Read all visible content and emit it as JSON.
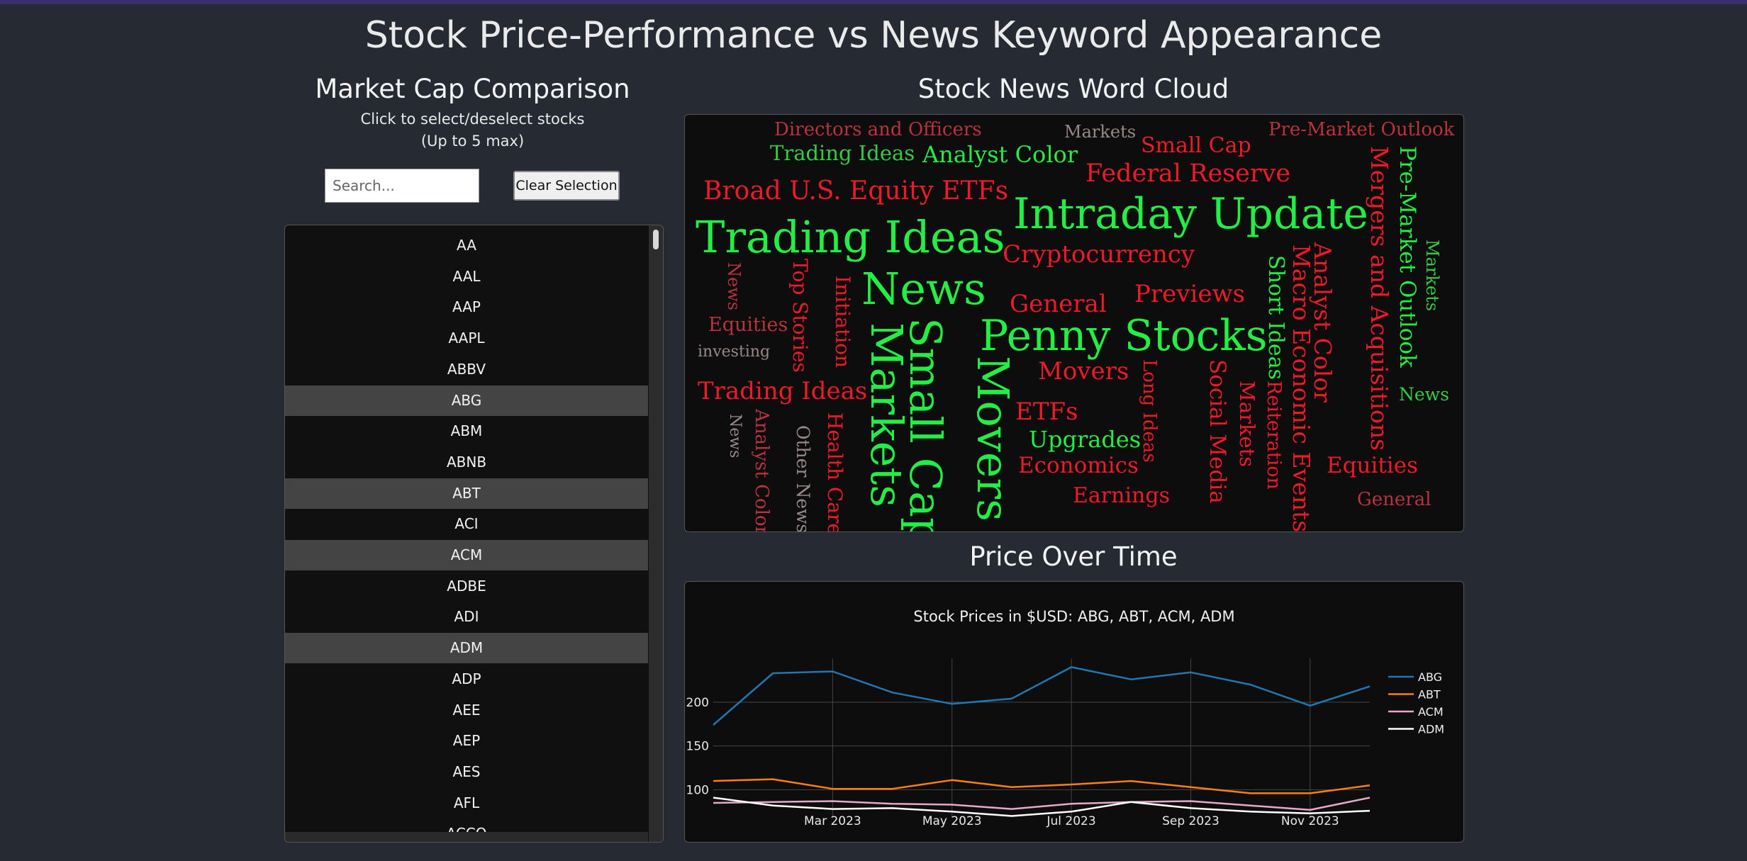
{
  "page": {
    "title": "Stock Price-Performance vs News Keyword Appearance"
  },
  "market_cap": {
    "title": "Market Cap Comparison",
    "subtitle_line1": "Click to select/deselect stocks",
    "subtitle_line2": "(Up to 5 max)",
    "search_placeholder": "Search...",
    "clear_label": "Clear Selection",
    "stocks": [
      {
        "symbol": "AA",
        "selected": false
      },
      {
        "symbol": "AAL",
        "selected": false
      },
      {
        "symbol": "AAP",
        "selected": false
      },
      {
        "symbol": "AAPL",
        "selected": false
      },
      {
        "symbol": "ABBV",
        "selected": false
      },
      {
        "symbol": "ABG",
        "selected": true
      },
      {
        "symbol": "ABM",
        "selected": false
      },
      {
        "symbol": "ABNB",
        "selected": false
      },
      {
        "symbol": "ABT",
        "selected": true
      },
      {
        "symbol": "ACI",
        "selected": false
      },
      {
        "symbol": "ACM",
        "selected": true
      },
      {
        "symbol": "ADBE",
        "selected": false
      },
      {
        "symbol": "ADI",
        "selected": false
      },
      {
        "symbol": "ADM",
        "selected": true
      },
      {
        "symbol": "ADP",
        "selected": false
      },
      {
        "symbol": "AEE",
        "selected": false
      },
      {
        "symbol": "AEP",
        "selected": false
      },
      {
        "symbol": "AES",
        "selected": false
      },
      {
        "symbol": "AFL",
        "selected": false
      },
      {
        "symbol": "ACCO",
        "selected": false
      }
    ]
  },
  "word_cloud": {
    "title": "Stock News Word Cloud",
    "colors": {
      "bright_green": "#22ee44",
      "mid_green": "#33cc44",
      "red": "#ee1a2a",
      "dark_red": "#b8333d",
      "gray": "#9a8888"
    },
    "words": [
      {
        "text": "Directors and Officers",
        "color": "dark_red"
      },
      {
        "text": "Markets",
        "color": "gray"
      },
      {
        "text": "Pre-Market Outlook",
        "color": "dark_red"
      },
      {
        "text": "Trading Ideas",
        "color": "mid_green"
      },
      {
        "text": "Analyst Color",
        "color": "bright_green"
      },
      {
        "text": "Small Cap",
        "color": "red"
      },
      {
        "text": "Federal Reserve",
        "color": "red"
      },
      {
        "text": "Broad U.S. Equity ETFs",
        "color": "red"
      },
      {
        "text": "Intraday Update",
        "color": "bright_green"
      },
      {
        "text": "Trading Ideas",
        "color": "bright_green"
      },
      {
        "text": "Cryptocurrency",
        "color": "red"
      },
      {
        "text": "News",
        "color": "bright_green"
      },
      {
        "text": "General",
        "color": "red"
      },
      {
        "text": "Previews",
        "color": "red"
      },
      {
        "text": "Penny Stocks",
        "color": "bright_green"
      },
      {
        "text": "Equities",
        "color": "dark_red"
      },
      {
        "text": "investing",
        "color": "gray"
      },
      {
        "text": "Movers",
        "color": "red"
      },
      {
        "text": "Trading Ideas",
        "color": "red"
      },
      {
        "text": "ETFs",
        "color": "red"
      },
      {
        "text": "Upgrades",
        "color": "bright_green"
      },
      {
        "text": "Economics",
        "color": "red"
      },
      {
        "text": "Earnings",
        "color": "red"
      },
      {
        "text": "News",
        "color": "mid_green"
      },
      {
        "text": "Equities",
        "color": "red"
      },
      {
        "text": "General",
        "color": "dark_red"
      },
      {
        "text": "Mergers and Acquisitions",
        "color": "red"
      },
      {
        "text": "Pre-Market Outlook",
        "color": "bright_green"
      },
      {
        "text": "Markets",
        "color": "mid_green"
      },
      {
        "text": "Analyst Color",
        "color": "red"
      },
      {
        "text": "Macro Economic Events",
        "color": "red"
      },
      {
        "text": "Short Ideas",
        "color": "bright_green"
      },
      {
        "text": "Reiteration",
        "color": "red"
      },
      {
        "text": "Markets",
        "color": "red"
      },
      {
        "text": "Social Media",
        "color": "red"
      },
      {
        "text": "Long Ideas",
        "color": "red"
      },
      {
        "text": "Movers",
        "color": "bright_green"
      },
      {
        "text": "Small Cap",
        "color": "bright_green"
      },
      {
        "text": "Markets",
        "color": "bright_green"
      },
      {
        "text": "Initiation",
        "color": "red"
      },
      {
        "text": "Top Stories",
        "color": "red"
      },
      {
        "text": "News",
        "color": "dark_red"
      },
      {
        "text": "Health Care",
        "color": "red"
      },
      {
        "text": "Other News",
        "color": "gray"
      },
      {
        "text": "Analyst Color",
        "color": "dark_red"
      },
      {
        "text": "News",
        "color": "gray"
      }
    ]
  },
  "price_chart": {
    "section_title": "Price Over Time",
    "colors": {
      "ABG": "#1f77b4",
      "ABT": "#ff7f0e",
      "ACM": "#e8a6c8",
      "ADM": "#ffffff"
    }
  },
  "chart_data": {
    "type": "line",
    "title": "Stock Prices in $USD: ABG, ABT, ACM, ADM",
    "xlabel": "",
    "ylabel": "",
    "x": [
      "2023-01",
      "2023-02",
      "2023-03",
      "2023-04",
      "2023-05",
      "2023-06",
      "2023-07",
      "2023-08",
      "2023-09",
      "2023-10",
      "2023-11",
      "2023-12"
    ],
    "x_ticks": [
      "Mar 2023",
      "May 2023",
      "Jul 2023",
      "Sep 2023",
      "Nov 2023"
    ],
    "y_ticks": [
      100,
      150,
      200
    ],
    "ylim": [
      68,
      250
    ],
    "grid": true,
    "legend_position": "right",
    "series": [
      {
        "name": "ABG",
        "values": [
          174,
          233,
          235,
          211,
          198,
          204,
          240,
          226,
          234,
          220,
          196,
          218
        ]
      },
      {
        "name": "ABT",
        "values": [
          110,
          112,
          101,
          101,
          111,
          103,
          106,
          110,
          103,
          96,
          96,
          105
        ]
      },
      {
        "name": "ACM",
        "values": [
          85,
          86,
          87,
          84,
          83,
          78,
          84,
          86,
          87,
          82,
          77,
          91
        ]
      },
      {
        "name": "ADM",
        "values": [
          91,
          82,
          78,
          79,
          75,
          70,
          75,
          86,
          79,
          75,
          73,
          76
        ]
      }
    ]
  }
}
